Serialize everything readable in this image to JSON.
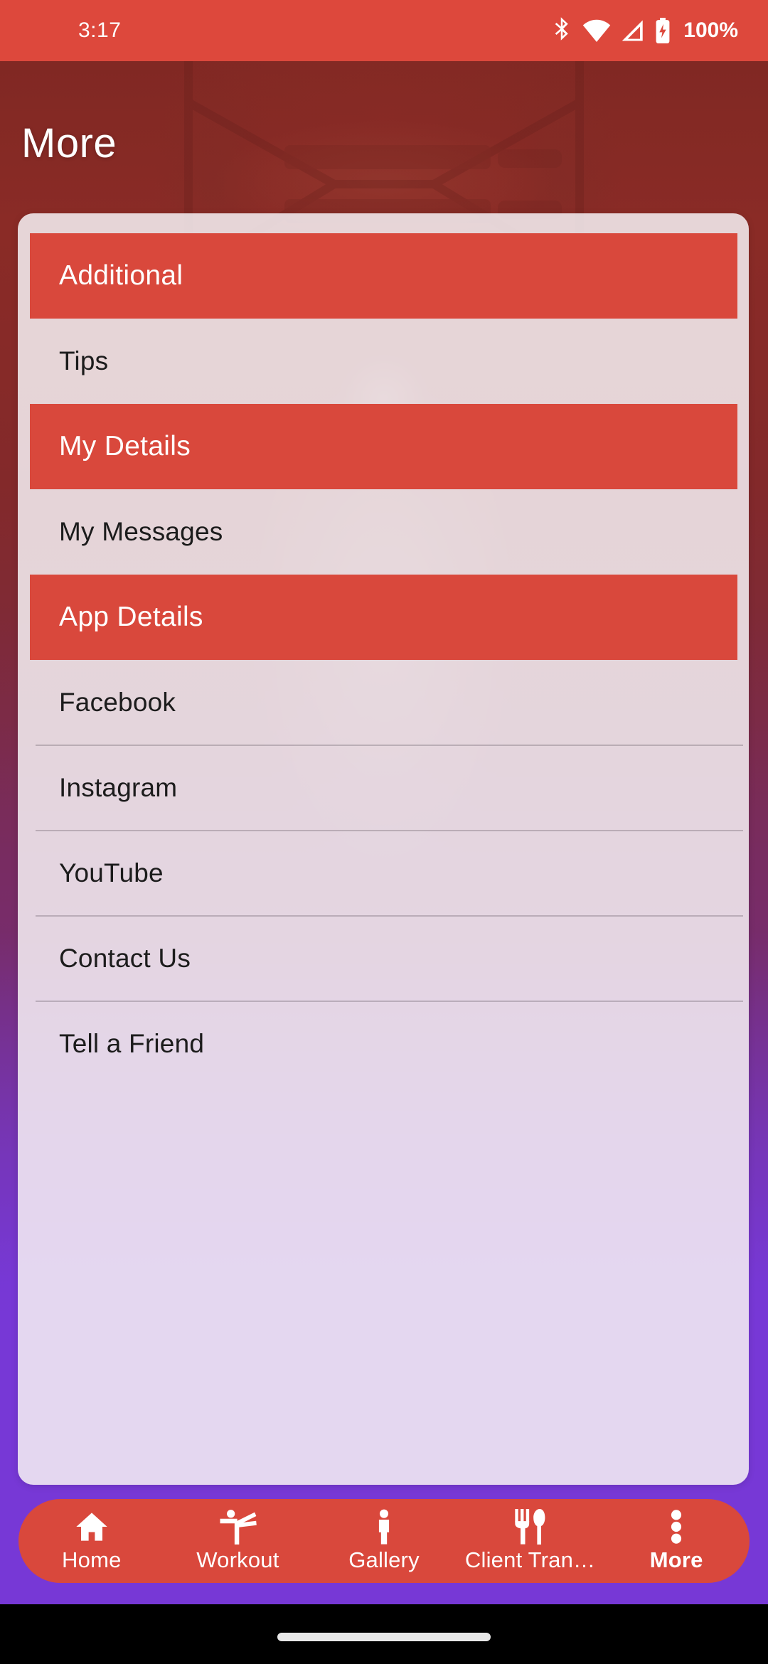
{
  "status_bar": {
    "time": "3:17",
    "battery_percent": "100%",
    "icons": [
      "bluetooth-icon",
      "wifi-icon",
      "cellular-signal-icon",
      "battery-charging-icon"
    ]
  },
  "header": {
    "title": "More"
  },
  "theme": {
    "accent_red": "#d9483c",
    "status_bar_red": "#dd483c",
    "background_purple": "#7738d6",
    "card_background": "#f6f1f4",
    "section_text": "#ffffff",
    "row_text": "#1c1c1c"
  },
  "list": {
    "sections": [
      {
        "title": "Additional",
        "items": [
          {
            "label": "Tips"
          }
        ]
      },
      {
        "title": "My Details",
        "items": [
          {
            "label": "My Messages"
          }
        ]
      },
      {
        "title": "App Details",
        "items": [
          {
            "label": "Facebook"
          },
          {
            "label": "Instagram"
          },
          {
            "label": "YouTube"
          },
          {
            "label": "Contact Us"
          },
          {
            "label": "Tell a Friend"
          }
        ]
      }
    ]
  },
  "bottom_nav": {
    "items": [
      {
        "label": "Home",
        "icon": "home-icon",
        "active": false
      },
      {
        "label": "Workout",
        "icon": "karate-kick-icon",
        "active": false
      },
      {
        "label": "Gallery",
        "icon": "person-icon",
        "active": false
      },
      {
        "label": "Client Tran…",
        "icon": "cutlery-icon",
        "active": false
      },
      {
        "label": "More",
        "icon": "three-dots-vertical-icon",
        "active": true
      }
    ]
  }
}
